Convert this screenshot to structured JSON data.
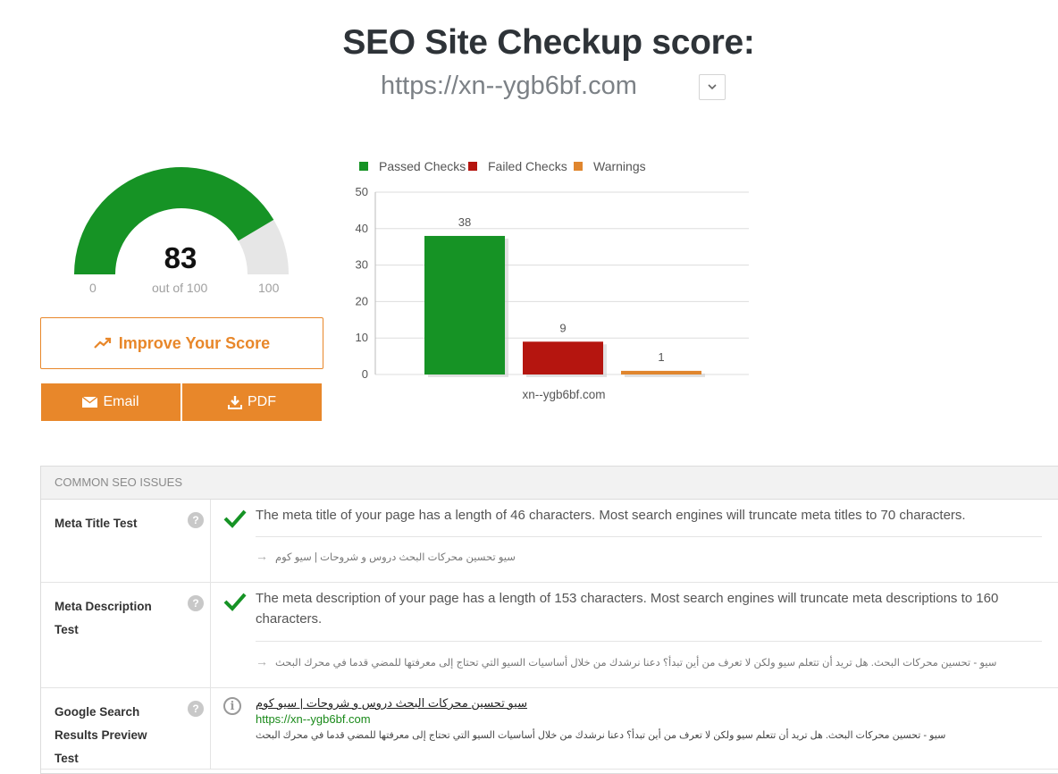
{
  "header": {
    "title": "SEO Site Checkup score:",
    "url": "https://xn--ygb6bf.com"
  },
  "score": {
    "value": "83",
    "out_of": "out of 100",
    "min_label": "0",
    "max_label": "100",
    "fraction": 0.83,
    "colors": {
      "filled": "#169325",
      "empty": "#e6e6e6"
    }
  },
  "buttons": {
    "improve": "Improve Your Score",
    "email": "Email",
    "pdf": "PDF",
    "accent": "#e8872a"
  },
  "chart_data": {
    "type": "bar",
    "categories": [
      "xn--ygb6bf.com"
    ],
    "series": [
      {
        "name": "Passed Checks",
        "values": [
          38
        ],
        "color": "#169325"
      },
      {
        "name": "Failed Checks",
        "values": [
          9
        ],
        "color": "#b5150f"
      },
      {
        "name": "Warnings",
        "values": [
          1
        ],
        "color": "#e0862e"
      }
    ],
    "y_ticks": [
      "0",
      "10",
      "20",
      "30",
      "40",
      "50"
    ],
    "ylim": [
      0,
      50
    ],
    "grid": true,
    "legend": "top"
  },
  "issues": {
    "header": "COMMON SEO ISSUES",
    "rows": [
      {
        "label": "Meta Title Test",
        "text": "The meta title of your page has a length of 46 characters. Most search engines will truncate meta titles to 70 characters.",
        "sample": "سيو تحسين محركات البحث دروس و شروحات | سيو كوم",
        "status": "passed"
      },
      {
        "label": "Meta Description Test",
        "text": "The meta description of your page has a length of 153 characters. Most search engines will truncate meta descriptions to 160 characters.",
        "sample": "سيو - تحسين محركات البحث. هل تريد أن تتعلم سيو ولكن لا تعرف من أين تبدأ؟ دعنا نرشدك من خلال أساسيات السيو التي تحتاج إلى معرفتها للمضي قدما في محرك البحث",
        "status": "passed"
      },
      {
        "label": "Google Search Results Preview Test",
        "preview_title": "سيو تحسين محركات البحث دروس و شروحات | سيو كوم",
        "preview_url": "https://xn--ygb6bf.com",
        "preview_desc": "سيو - تحسين محركات البحث. هل تريد أن تتعلم سيو ولكن لا تعرف من أين تبدأ؟ دعنا نرشدك من خلال أساسيات السيو التي تحتاج إلى معرفتها للمضي قدما في محرك البحث",
        "status": "info"
      }
    ]
  }
}
